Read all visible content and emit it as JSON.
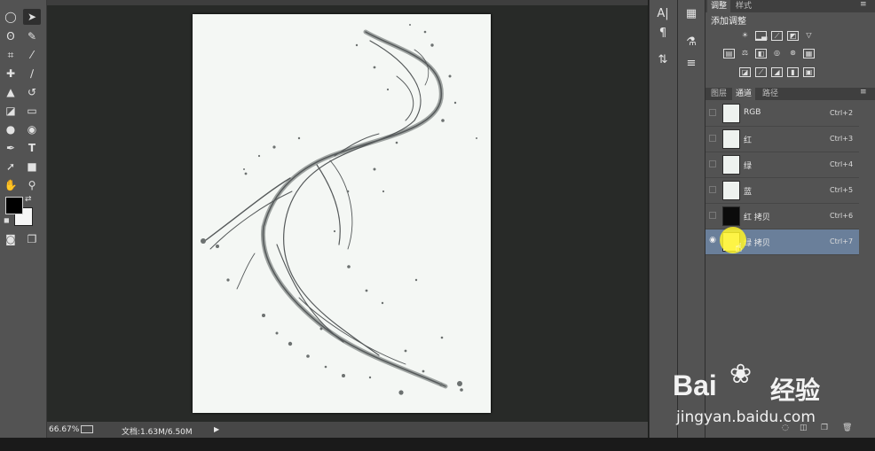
{
  "document": {
    "zoom": "66.67%",
    "doc_size": "文档:1.63M/6.50M"
  },
  "panels": {
    "adjustments": {
      "tabs": [
        "调整",
        "样式"
      ],
      "active_tab": "调整",
      "title": "添加调整"
    },
    "channels": {
      "tabs": [
        "图层",
        "通道",
        "路径"
      ],
      "active_tab": "通道",
      "rows": [
        {
          "name": "RGB",
          "shortcut": "Ctrl+2",
          "visible": false,
          "selected": false,
          "thumb": "light"
        },
        {
          "name": "红",
          "shortcut": "Ctrl+3",
          "visible": false,
          "selected": false,
          "thumb": "light"
        },
        {
          "name": "绿",
          "shortcut": "Ctrl+4",
          "visible": false,
          "selected": false,
          "thumb": "light"
        },
        {
          "name": "蓝",
          "shortcut": "Ctrl+5",
          "visible": false,
          "selected": false,
          "thumb": "light"
        },
        {
          "name": "红 拷贝",
          "shortcut": "Ctrl+6",
          "visible": false,
          "selected": false,
          "thumb": "dark"
        },
        {
          "name": "绿 拷贝",
          "shortcut": "Ctrl+7",
          "visible": true,
          "selected": true,
          "thumb": "light"
        }
      ]
    }
  },
  "watermark": {
    "brand": "Bai",
    "brand2": "经验",
    "url": "jingyan.baidu.com"
  },
  "icons": {
    "tools": [
      "marquee-icon",
      "move-icon",
      "lasso-icon",
      "quick-select-icon",
      "crop-icon",
      "eyedropper-icon",
      "healing-icon",
      "brush-icon",
      "stamp-icon",
      "history-brush-icon",
      "eraser-icon",
      "gradient-icon",
      "blur-icon",
      "dodge-icon",
      "pen-icon",
      "type-icon",
      "path-select-icon",
      "shape-icon",
      "hand-icon",
      "zoom-icon"
    ],
    "dock1": [
      "character-icon",
      "paragraph-icon",
      "tool-presets-icon"
    ],
    "dock2": [
      "color-icon",
      "brush-presets-icon",
      "properties-icon"
    ]
  }
}
